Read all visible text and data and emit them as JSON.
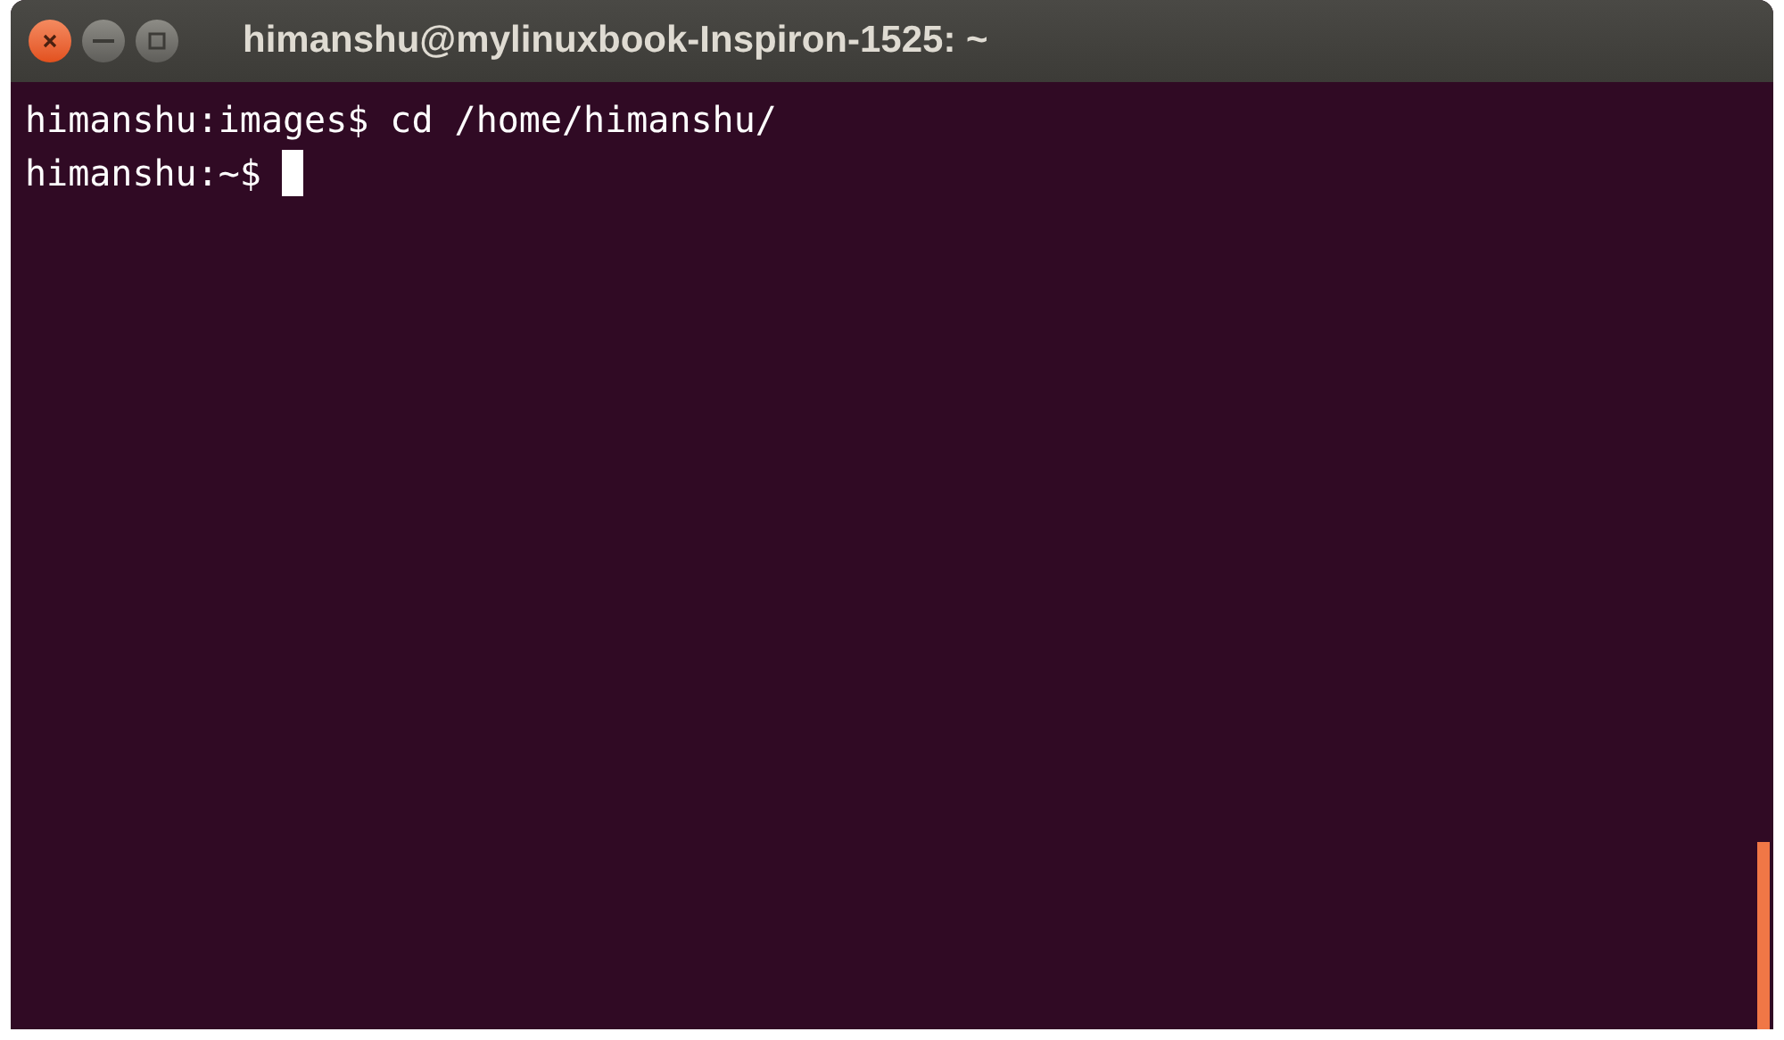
{
  "window": {
    "title": "himanshu@mylinuxbook-Inspiron-1525: ~"
  },
  "terminal": {
    "lines": [
      {
        "prompt": "himanshu:images$",
        "command": "cd /home/himanshu/"
      },
      {
        "prompt": "himanshu:~$"
      }
    ],
    "cursor": true
  }
}
